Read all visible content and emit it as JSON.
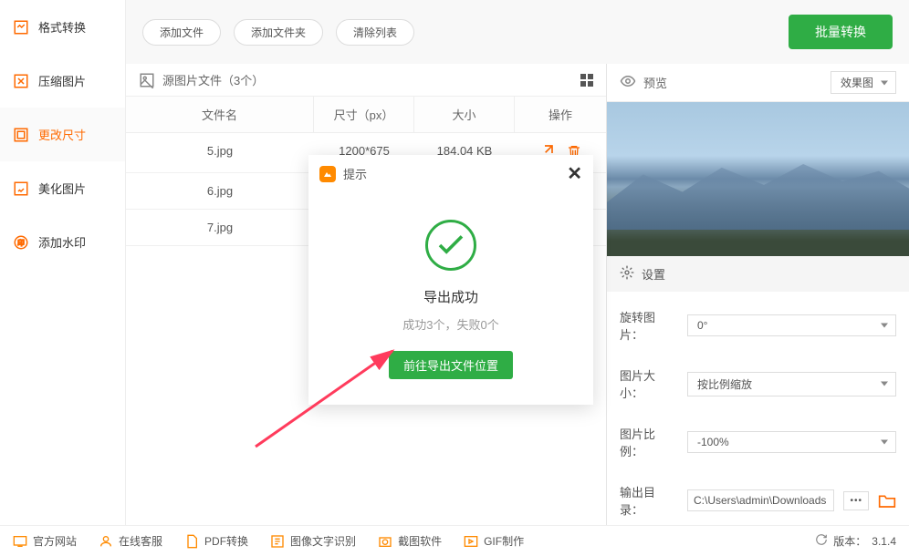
{
  "sidebar": {
    "items": [
      {
        "label": "格式转换",
        "name": "format-convert"
      },
      {
        "label": "压缩图片",
        "name": "compress-image"
      },
      {
        "label": "更改尺寸",
        "name": "change-size"
      },
      {
        "label": "美化图片",
        "name": "beautify-image"
      },
      {
        "label": "添加水印",
        "name": "add-watermark"
      }
    ]
  },
  "toolbar": {
    "add_file": "添加文件",
    "add_folder": "添加文件夹",
    "clear_list": "清除列表",
    "batch_convert": "批量转换"
  },
  "source_header": "源图片文件（3个）",
  "table": {
    "columns": {
      "name": "文件名",
      "dim": "尺寸（px）",
      "size": "大小",
      "op": "操作"
    },
    "rows": [
      {
        "name": "5.jpg",
        "dim": "1200*675",
        "size": "184.04 KB"
      },
      {
        "name": "6.jpg",
        "dim": "",
        "size": ""
      },
      {
        "name": "7.jpg",
        "dim": "",
        "size": ""
      }
    ]
  },
  "preview": {
    "title": "预览",
    "mode": "效果图"
  },
  "settings": {
    "title": "设置",
    "rotate_label": "旋转图片：",
    "rotate_value": "0°",
    "size_label": "图片大小：",
    "size_value": "按比例缩放",
    "ratio_label": "图片比例：",
    "ratio_value": "-100%",
    "output_label": "输出目录：",
    "output_value": "C:\\Users\\admin\\Downloads"
  },
  "modal": {
    "header": "提示",
    "title": "导出成功",
    "subtitle": "成功3个，失败0个",
    "button": "前往导出文件位置"
  },
  "footer": {
    "items": [
      {
        "label": "官方网站"
      },
      {
        "label": "在线客服"
      },
      {
        "label": "PDF转换"
      },
      {
        "label": "图像文字识别"
      },
      {
        "label": "截图软件"
      },
      {
        "label": "GIF制作"
      }
    ],
    "version_label": "版本：",
    "version": "3.1.4"
  }
}
